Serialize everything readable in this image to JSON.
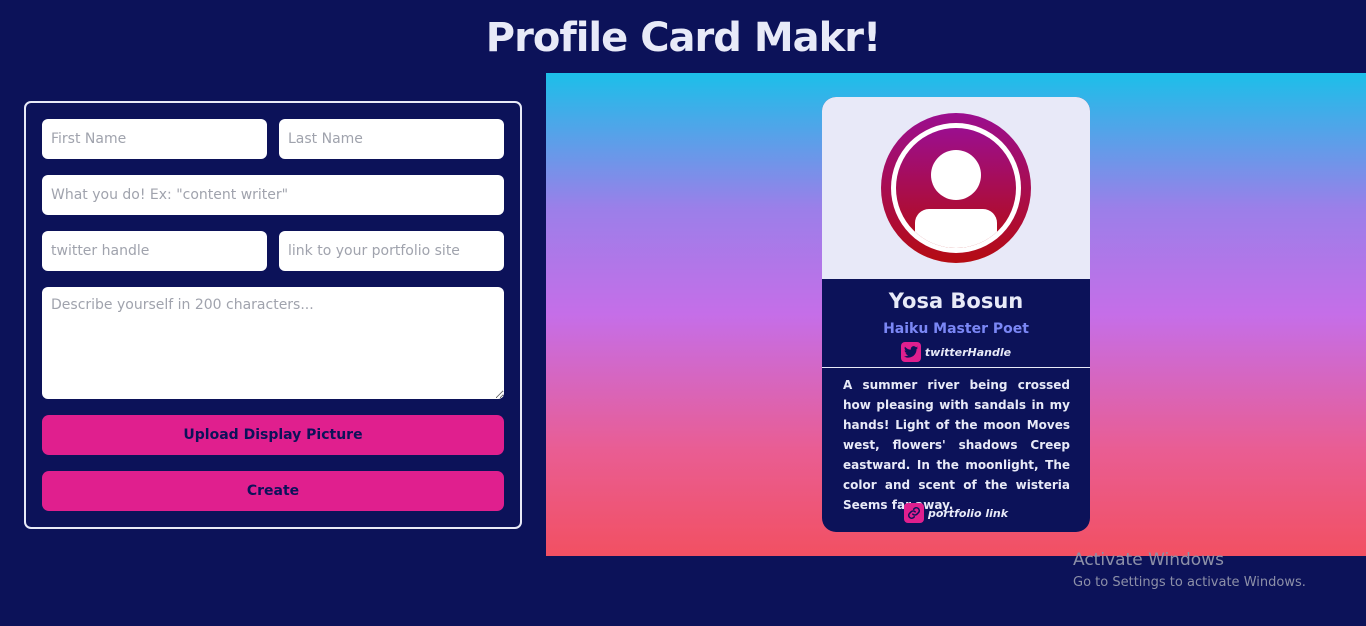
{
  "app": {
    "title": "Profile Card Makr!"
  },
  "form": {
    "first_name_placeholder": "First Name",
    "last_name_placeholder": "Last Name",
    "role_placeholder": "What you do! Ex: \"content writer\"",
    "twitter_placeholder": "twitter handle",
    "portfolio_placeholder": "link to your portfolio site",
    "bio_placeholder": "Describe yourself in 200 characters...",
    "upload_label": "Upload Display Picture",
    "create_label": "Create"
  },
  "card": {
    "name": "Yosa Bosun",
    "role": "Haiku Master Poet",
    "twitter_handle": "twitterHandle",
    "twitter_icon": "twitter-icon",
    "bio": "A summer river being crossed how pleasing with sandals in my hands! Light of the moon Moves west, flowers' shadows Creep eastward. In the moonlight, The color and scent of the wisteria Seems far away.",
    "portfolio_label": "portfolio link",
    "portfolio_icon": "link-icon",
    "avatar_icon": "user-avatar-icon"
  },
  "watermark": {
    "title": "Activate Windows",
    "subtitle": "Go to Settings to activate Windows."
  },
  "colors": {
    "background": "#0c1259",
    "accent": "#e01f8e",
    "role_text": "#7b87f5",
    "card_top": "#e8e9f8"
  }
}
